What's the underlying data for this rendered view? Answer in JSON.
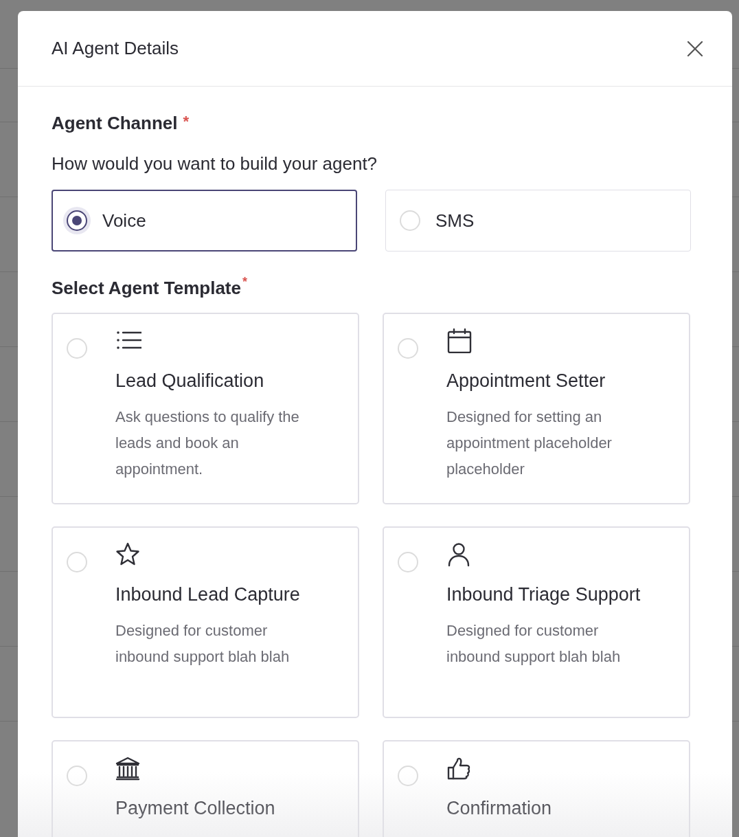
{
  "dialog": {
    "title": "AI Agent Details"
  },
  "channel": {
    "label": "Agent Channel",
    "required_mark": "*",
    "question": "How would you want to build your agent?",
    "options": [
      {
        "label": "Voice",
        "selected": true
      },
      {
        "label": "SMS",
        "selected": false
      }
    ]
  },
  "template": {
    "label": "Select Agent Template",
    "required_mark": "*",
    "options": [
      {
        "kind": "list",
        "title": "Lead Qualification",
        "description": "Ask questions to qualify the leads and book an appointment.",
        "selected": false
      },
      {
        "kind": "calendar",
        "title": "Appointment Setter",
        "description": "Designed for setting an appointment placeholder placeholder",
        "selected": false
      },
      {
        "kind": "star",
        "title": "Inbound Lead Capture",
        "description": "Designed for customer inbound support blah blah",
        "selected": false
      },
      {
        "kind": "person",
        "title": "Inbound Triage Support",
        "description": "Designed for customer inbound support blah blah",
        "selected": false
      },
      {
        "kind": "bank",
        "title": "Payment Collection",
        "selected": false
      },
      {
        "kind": "thumbs-up",
        "title": "Confirmation",
        "selected": false
      }
    ]
  }
}
